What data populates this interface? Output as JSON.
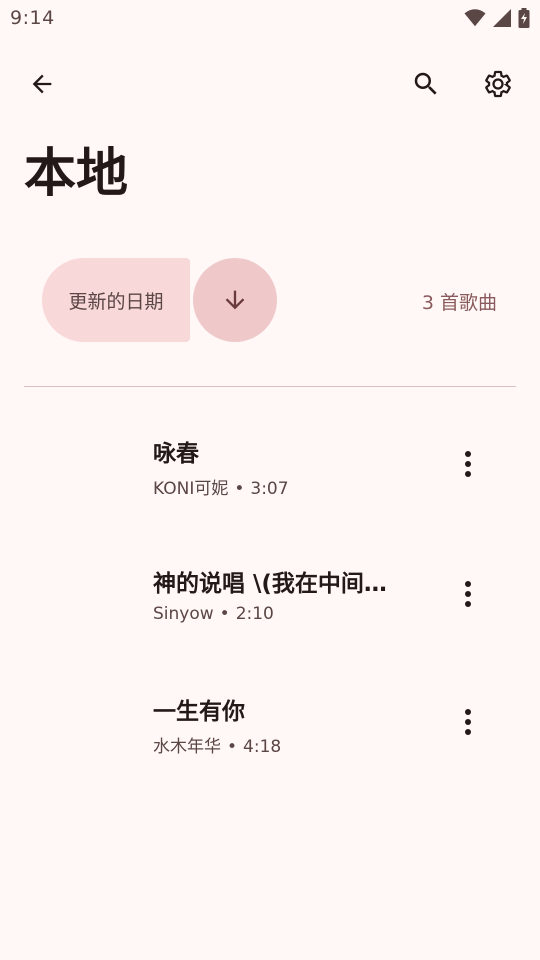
{
  "status_bar": {
    "time": "9:14",
    "icons": [
      "wifi-icon",
      "cell-signal-icon",
      "battery-icon"
    ]
  },
  "app_bar": {
    "icons": [
      "back-arrow-icon",
      "search-icon",
      "settings-gear-icon"
    ]
  },
  "page": {
    "title": "本地"
  },
  "sort": {
    "label": "更新的日期",
    "direction_icon": "arrow-down-icon",
    "song_count": "3 首歌曲"
  },
  "songs": [
    {
      "title": "咏春",
      "artist": "KONI可妮",
      "separator": "•",
      "duration": "3:07"
    },
    {
      "title": "神的说唱 \\(我在中间…",
      "artist": "Sinyow",
      "separator": "•",
      "duration": "2:10"
    },
    {
      "title": "一生有你",
      "artist": "水木年华",
      "separator": "•",
      "duration": "4:18"
    }
  ],
  "colors": {
    "background": "#fff8f6",
    "sort_chip": "#f8d8d8",
    "sort_direction_button": "#efc9ca",
    "count_text": "#8a5a5c",
    "primary_text": "#231918"
  }
}
